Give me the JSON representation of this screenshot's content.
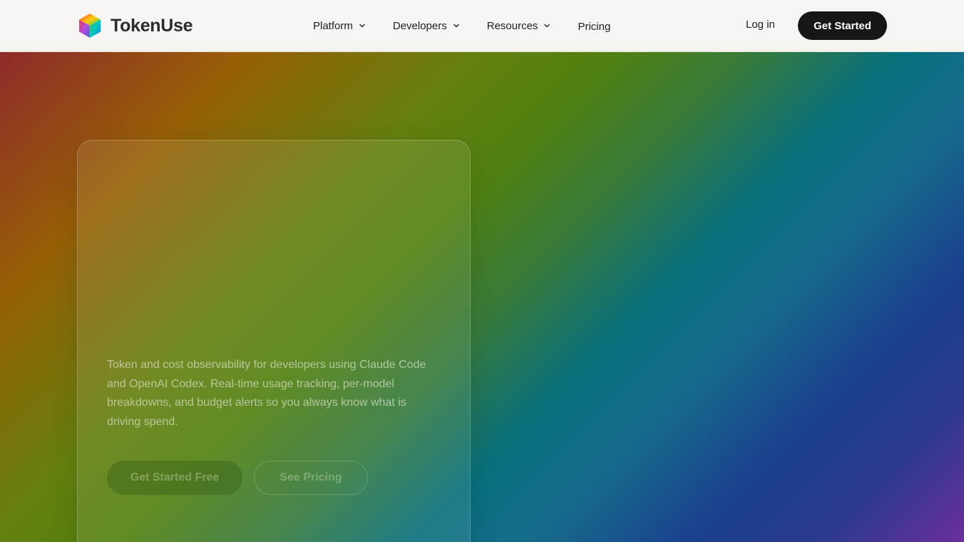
{
  "nav": {
    "brand": "TokenUse",
    "menu": [
      {
        "label": "Platform",
        "has_dropdown": true
      },
      {
        "label": "Developers",
        "has_dropdown": true
      },
      {
        "label": "Resources",
        "has_dropdown": true
      },
      {
        "label": "Pricing",
        "has_dropdown": false
      }
    ],
    "login_label": "Log in",
    "cta_label": "Get Started"
  },
  "hero": {
    "description": "Token and cost observability for developers using Claude Code and OpenAI Codex. Real-time usage tracking, per-model breakdowns, and budget alerts so you always know what is driving spend.",
    "primary_button": "Get Started Free",
    "secondary_button": "See Pricing"
  },
  "colors": {
    "nav_background": "#f6f5f1",
    "cta_background": "#171717",
    "gradient_stops": [
      "#8f2a2a",
      "#975f06",
      "#64800f",
      "#518010",
      "#08707c",
      "#1a3d8e",
      "#6a2f9a"
    ]
  },
  "icons": {
    "logo": "rainbow-cube-icon",
    "dropdown": "chevron-down-icon"
  }
}
